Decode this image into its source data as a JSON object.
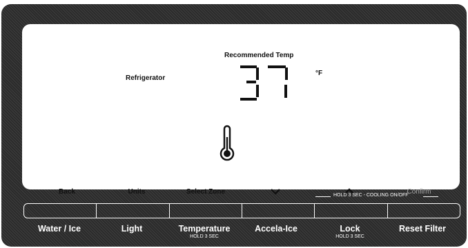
{
  "display": {
    "recommended_label": "Recommended Temp",
    "zone_label": "Refrigerator",
    "temperature": "37",
    "unit": "°F",
    "thermometer_icon": "thermometer-icon"
  },
  "soft_keys": {
    "back": "Back",
    "units": "Units",
    "select_zone": "Select Zone",
    "down_icon": "chevron-down-icon",
    "up_icon": "chevron-up-icon",
    "confirm": "Confirm"
  },
  "hold_banner": "HOLD 3 SEC - COOLING ON/OFF",
  "buttons": [
    {
      "label": "Water / Ice",
      "sub": ""
    },
    {
      "label": "Light",
      "sub": ""
    },
    {
      "label": "Temperature",
      "sub": "HOLD 3 SEC"
    },
    {
      "label": "Accela-Ice",
      "sub": ""
    },
    {
      "label": "Lock",
      "sub": "HOLD 3 SEC"
    },
    {
      "label": "Reset Filter",
      "sub": ""
    }
  ],
  "colors": {
    "panel": "#2b2b2b",
    "screen": "#ffffff",
    "text_dark": "#111111",
    "text_disabled": "#a8a8a8"
  }
}
